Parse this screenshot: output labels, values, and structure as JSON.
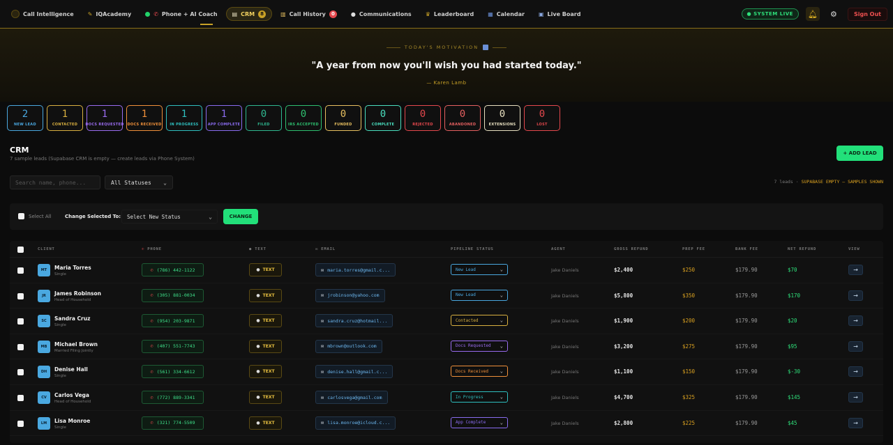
{
  "nav": {
    "brand": "Call Intelligence",
    "items": [
      {
        "label": "IQAcademy",
        "icon": "graduation-icon"
      },
      {
        "label": "Phone + AI Coach",
        "icon": "phone-icon"
      },
      {
        "label": "CRM",
        "icon": "document-icon",
        "badge": "8"
      },
      {
        "label": "Call History",
        "icon": "scroll-icon",
        "badge": "0"
      },
      {
        "label": "Communications",
        "icon": "chat-icon"
      },
      {
        "label": "Leaderboard",
        "icon": "trophy-icon"
      },
      {
        "label": "Calendar",
        "icon": "calendar-icon"
      },
      {
        "label": "Live Board",
        "icon": "board-icon"
      }
    ],
    "system_status": "● SYSTEM LIVE",
    "sign_out": "Sign Out"
  },
  "motivation": {
    "label": "TODAY'S MOTIVATION",
    "quote": "\"A year from now you'll wish you had started today.\"",
    "author": "— Karen Lamb"
  },
  "status_cards": [
    {
      "count": "2",
      "label": "NEW LEAD",
      "color": "#4aa8e0"
    },
    {
      "count": "1",
      "label": "CONTACTED",
      "color": "#d9b040"
    },
    {
      "count": "1",
      "label": "DOCS REQUESTED",
      "color": "#9a6cf0"
    },
    {
      "count": "1",
      "label": "DOCS RECEIVED",
      "color": "#f0903a"
    },
    {
      "count": "1",
      "label": "IN PROGRESS",
      "color": "#2fc0c0"
    },
    {
      "count": "1",
      "label": "APP COMPLETE",
      "color": "#8a6cf0"
    },
    {
      "count": "0",
      "label": "FILED",
      "color": "#2fb890"
    },
    {
      "count": "0",
      "label": "IRS ACCEPTED",
      "color": "#2ec070"
    },
    {
      "count": "0",
      "label": "FUNDED",
      "color": "#e8c060"
    },
    {
      "count": "0",
      "label": "COMPLETE",
      "color": "#4ae0c0"
    },
    {
      "count": "0",
      "label": "REJECTED",
      "color": "#e5484d"
    },
    {
      "count": "0",
      "label": "ABANDONED",
      "color": "#e56060"
    },
    {
      "count": "0",
      "label": "EXTENSIONS",
      "color": "#e8e0c0"
    },
    {
      "count": "0",
      "label": "LOST",
      "color": "#e5484d"
    }
  ],
  "crm": {
    "title": "CRM",
    "subtitle": "7 sample leads (Supabase CRM is empty — create leads via Phone System)",
    "add_lead": "+ ADD LEAD",
    "search_placeholder": "Search name, phone...",
    "status_filter": "All Statuses",
    "leads_count": "7 leads · ",
    "leads_warning": "SUPABASE EMPTY — SAMPLES SHOWN"
  },
  "bulk": {
    "select_all": "Select All",
    "change_to": "Change Selected To:",
    "new_status": "Select New Status",
    "change_btn": "CHANGE"
  },
  "table": {
    "headers": {
      "client": "CLIENT",
      "phone": "PHONE",
      "text": "TEXT",
      "email": "EMAIL",
      "pipeline": "PIPELINE STATUS",
      "agent": "AGENT",
      "gross": "GROSS REFUND",
      "prep": "PREP FEE",
      "bank": "BANK FEE",
      "net": "NET REFUND",
      "view": "VIEW"
    },
    "text_label": "TEXT",
    "view_arrow": "→",
    "rows": [
      {
        "initials": "MT",
        "name": "Maria Torres",
        "type": "Single",
        "phone": "(786) 442-1122",
        "email": "maria.torres@gmail.c...",
        "status": "New Lead",
        "status_color": "#4aa8e0",
        "agent": "Jake Daniels",
        "gross": "$2,400",
        "prep": "$250",
        "bank": "$179.90",
        "net": "$70"
      },
      {
        "initials": "JR",
        "name": "James Robinson",
        "type": "Head of Household",
        "phone": "(305) 881-0034",
        "email": "jrobinson@yahoo.com",
        "status": "New Lead",
        "status_color": "#4aa8e0",
        "agent": "Jake Daniels",
        "gross": "$5,800",
        "prep": "$350",
        "bank": "$179.90",
        "net": "$170"
      },
      {
        "initials": "SC",
        "name": "Sandra Cruz",
        "type": "Single",
        "phone": "(954) 203-9871",
        "email": "sandra.cruz@hotmail...",
        "status": "Contacted",
        "status_color": "#d9b040",
        "agent": "Jake Daniels",
        "gross": "$1,900",
        "prep": "$200",
        "bank": "$179.90",
        "net": "$20"
      },
      {
        "initials": "MB",
        "name": "Michael Brown",
        "type": "Married Filing Jointly",
        "phone": "(407) 551-7743",
        "email": "mbrown@outlook.com",
        "status": "Docs Requested",
        "status_color": "#9a6cf0",
        "agent": "Jake Daniels",
        "gross": "$3,200",
        "prep": "$275",
        "bank": "$179.90",
        "net": "$95"
      },
      {
        "initials": "DH",
        "name": "Denise Hall",
        "type": "Single",
        "phone": "(561) 334-6612",
        "email": "denise.hall@gmail.c...",
        "status": "Docs Received",
        "status_color": "#f0903a",
        "agent": "Jake Daniels",
        "gross": "$1,100",
        "prep": "$150",
        "bank": "$179.90",
        "net": "$-30"
      },
      {
        "initials": "CV",
        "name": "Carlos Vega",
        "type": "Head of Household",
        "phone": "(772) 889-3341",
        "email": "carlosvega@gmail.com",
        "status": "In Progress",
        "status_color": "#2fc0c0",
        "agent": "Jake Daniels",
        "gross": "$4,700",
        "prep": "$325",
        "bank": "$179.90",
        "net": "$145"
      },
      {
        "initials": "LM",
        "name": "Lisa Monroe",
        "type": "Single",
        "phone": "(321) 774-5509",
        "email": "lisa.monroe@icloud.c...",
        "status": "App Complete",
        "status_color": "#8a6cf0",
        "agent": "Jake Daniels",
        "gross": "$2,800",
        "prep": "$225",
        "bank": "$179.90",
        "net": "$45"
      }
    ]
  }
}
